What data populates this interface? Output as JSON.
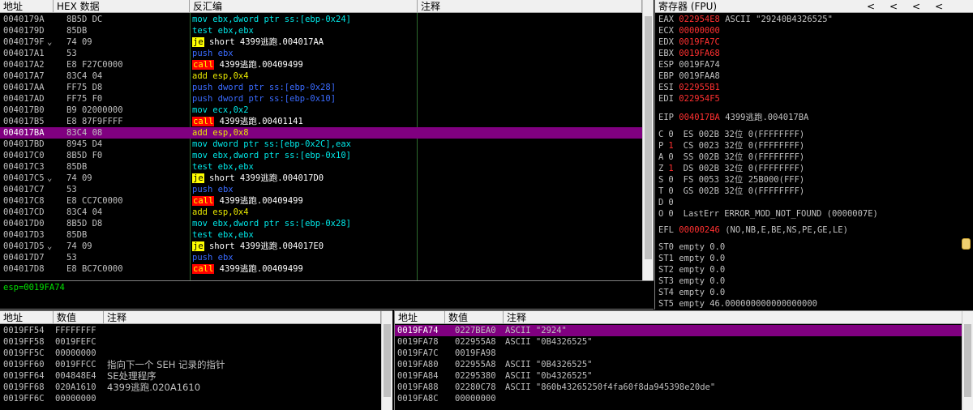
{
  "cpu": {
    "headers": {
      "addr": "地址",
      "hex": "HEX 数据",
      "disasm": "反汇编",
      "comment": "注释"
    },
    "rows": [
      {
        "addr": "0040179A",
        "mark": "",
        "hex": "8B5D DC",
        "mn": "mov",
        "mc": "c-mov",
        "op": " ebx,dword ptr ss:[ebp-0x24]",
        "sel": false
      },
      {
        "addr": "0040179D",
        "mark": "",
        "hex": "85DB",
        "mn": "test",
        "mc": "c-test",
        "op": " ebx,ebx",
        "sel": false
      },
      {
        "addr": "0040179F",
        "mark": "⌄",
        "hex": "74 09",
        "mn": "je",
        "mc": "c-je",
        "op": " short 4399逃跑.004017AA",
        "sel": false
      },
      {
        "addr": "004017A1",
        "mark": "",
        "hex": "53",
        "mn": "push",
        "mc": "c-push",
        "op": " ebx",
        "sel": false
      },
      {
        "addr": "004017A2",
        "mark": "",
        "hex": "E8 F27C0000",
        "mn": "call",
        "mc": "c-call",
        "op": " 4399逃跑.00409499",
        "sel": false
      },
      {
        "addr": "004017A7",
        "mark": "",
        "hex": "83C4 04",
        "mn": "add",
        "mc": "c-add",
        "op": " esp,0x4",
        "sel": false
      },
      {
        "addr": "004017AA",
        "mark": "",
        "hex": "FF75 D8",
        "mn": "push",
        "mc": "c-push",
        "op": " dword ptr ss:[ebp-0x28]",
        "sel": false
      },
      {
        "addr": "004017AD",
        "mark": "",
        "hex": "FF75 F0",
        "mn": "push",
        "mc": "c-push",
        "op": " dword ptr ss:[ebp-0x10]",
        "sel": false
      },
      {
        "addr": "004017B0",
        "mark": "",
        "hex": "B9 02000000",
        "mn": "mov",
        "mc": "c-mov",
        "op": " ecx,0x2",
        "sel": false
      },
      {
        "addr": "004017B5",
        "mark": "",
        "hex": "E8 87F9FFFF",
        "mn": "call",
        "mc": "c-call",
        "op": " 4399逃跑.00401141",
        "sel": false
      },
      {
        "addr": "004017BA",
        "mark": "",
        "hex": "83C4 08",
        "mn": "add",
        "mc": "c-add",
        "op": " esp,0x8",
        "sel": true
      },
      {
        "addr": "004017BD",
        "mark": "",
        "hex": "8945 D4",
        "mn": "mov",
        "mc": "c-mov",
        "op": " dword ptr ss:[ebp-0x2C],eax",
        "sel": false
      },
      {
        "addr": "004017C0",
        "mark": "",
        "hex": "8B5D F0",
        "mn": "mov",
        "mc": "c-mov",
        "op": " ebx,dword ptr ss:[ebp-0x10]",
        "sel": false
      },
      {
        "addr": "004017C3",
        "mark": "",
        "hex": "85DB",
        "mn": "test",
        "mc": "c-test",
        "op": " ebx,ebx",
        "sel": false
      },
      {
        "addr": "004017C5",
        "mark": "⌄",
        "hex": "74 09",
        "mn": "je",
        "mc": "c-je",
        "op": " short 4399逃跑.004017D0",
        "sel": false
      },
      {
        "addr": "004017C7",
        "mark": "",
        "hex": "53",
        "mn": "push",
        "mc": "c-push",
        "op": " ebx",
        "sel": false
      },
      {
        "addr": "004017C8",
        "mark": "",
        "hex": "E8 CC7C0000",
        "mn": "call",
        "mc": "c-call",
        "op": " 4399逃跑.00409499",
        "sel": false
      },
      {
        "addr": "004017CD",
        "mark": "",
        "hex": "83C4 04",
        "mn": "add",
        "mc": "c-add",
        "op": " esp,0x4",
        "sel": false
      },
      {
        "addr": "004017D0",
        "mark": "",
        "hex": "8B5D D8",
        "mn": "mov",
        "mc": "c-mov",
        "op": " ebx,dword ptr ss:[ebp-0x28]",
        "sel": false
      },
      {
        "addr": "004017D3",
        "mark": "",
        "hex": "85DB",
        "mn": "test",
        "mc": "c-test",
        "op": " ebx,ebx",
        "sel": false
      },
      {
        "addr": "004017D5",
        "mark": "⌄",
        "hex": "74 09",
        "mn": "je",
        "mc": "c-je",
        "op": " short 4399逃跑.004017E0",
        "sel": false
      },
      {
        "addr": "004017D7",
        "mark": "",
        "hex": "53",
        "mn": "push",
        "mc": "c-push",
        "op": " ebx",
        "sel": false
      },
      {
        "addr": "004017D8",
        "mark": "",
        "hex": "E8 BC7C0000",
        "mn": "call",
        "mc": "c-call",
        "op": " 4399逃跑.00409499",
        "sel": false
      }
    ],
    "info": "esp=0019FA74"
  },
  "registers": {
    "title": "寄存器 (FPU)",
    "nav": [
      "<",
      "<",
      "<",
      "<"
    ],
    "gp": [
      {
        "name": "EAX",
        "val": "022954E8",
        "note": " ASCII \"29240B4326525\"",
        "red": true
      },
      {
        "name": "ECX",
        "val": "00000000",
        "note": "",
        "red": true
      },
      {
        "name": "EDX",
        "val": "0019FA7C",
        "note": "",
        "red": true
      },
      {
        "name": "EBX",
        "val": "0019FA68",
        "note": "",
        "red": true
      },
      {
        "name": "ESP",
        "val": "0019FA74",
        "note": "",
        "red": false
      },
      {
        "name": "EBP",
        "val": "0019FAA8",
        "note": "",
        "red": false
      },
      {
        "name": "ESI",
        "val": "022955B1",
        "note": "",
        "red": true
      },
      {
        "name": "EDI",
        "val": "022954F5",
        "note": "",
        "red": true
      }
    ],
    "eip": {
      "name": "EIP",
      "val": "004017BA",
      "note": " 4399逃跑.004017BA"
    },
    "flags": [
      {
        "f": "C",
        "v": "0",
        "red": false,
        "seg": "ES 002B 32位 0(FFFFFFFF)"
      },
      {
        "f": "P",
        "v": "1",
        "red": true,
        "seg": "CS 0023 32位 0(FFFFFFFF)"
      },
      {
        "f": "A",
        "v": "0",
        "red": false,
        "seg": "SS 002B 32位 0(FFFFFFFF)"
      },
      {
        "f": "Z",
        "v": "1",
        "red": true,
        "seg": "DS 002B 32位 0(FFFFFFFF)"
      },
      {
        "f": "S",
        "v": "0",
        "red": false,
        "seg": "FS 0053 32位 25B000(FFF)"
      },
      {
        "f": "T",
        "v": "0",
        "red": false,
        "seg": "GS 002B 32位 0(FFFFFFFF)"
      },
      {
        "f": "D",
        "v": "0",
        "red": false,
        "seg": ""
      },
      {
        "f": "O",
        "v": "0",
        "red": false,
        "seg": "LastErr ERROR_MOD_NOT_FOUND (0000007E)"
      }
    ],
    "efl": {
      "name": "EFL",
      "val": "00000246",
      "note": " (NO,NB,E,BE,NS,PE,GE,LE)"
    },
    "fpu": [
      "ST0 empty 0.0",
      "ST1 empty 0.0",
      "ST2 empty 0.0",
      "ST3 empty 0.0",
      "ST4 empty 0.0",
      "ST5 empty 46.000000000000000000"
    ]
  },
  "dump": {
    "headers": {
      "addr": "地址",
      "val": "数值",
      "comment": "注释"
    },
    "rows": [
      {
        "addr": "0019FF54",
        "val": "FFFFFFFF",
        "comment": ""
      },
      {
        "addr": "0019FF58",
        "val": "0019FEFC",
        "comment": ""
      },
      {
        "addr": "0019FF5C",
        "val": "00000000",
        "comment": ""
      },
      {
        "addr": "0019FF60",
        "val": "0019FFCC",
        "comment": "指向下一个 SEH 记录的指针"
      },
      {
        "addr": "0019FF64",
        "val": "004848E4",
        "comment": "SE处理程序"
      },
      {
        "addr": "0019FF68",
        "val": "020A1610",
        "comment": "4399逃跑.020A1610"
      },
      {
        "addr": "0019FF6C",
        "val": "00000000",
        "comment": ""
      }
    ]
  },
  "stack": {
    "headers": {
      "addr": "地址",
      "val": "数值",
      "comment": "注释"
    },
    "rows": [
      {
        "addr": "0019FA74",
        "val": "0227BEA0",
        "comment": "ASCII \"2924\"",
        "sel": true
      },
      {
        "addr": "0019FA78",
        "val": "022955A8",
        "comment": "ASCII \"0B4326525\"",
        "sel": false
      },
      {
        "addr": "0019FA7C",
        "val": "0019FA98",
        "comment": "",
        "sel": false
      },
      {
        "addr": "0019FA80",
        "val": "022955A8",
        "comment": "ASCII \"0B4326525\"",
        "sel": false
      },
      {
        "addr": "0019FA84",
        "val": "02295380",
        "comment": "ASCII \"0b4326525\"",
        "sel": false
      },
      {
        "addr": "0019FA88",
        "val": "02280C78",
        "comment": "ASCII \"860b43265250f4fa60f8da945398e20de\"",
        "sel": false
      },
      {
        "addr": "0019FA8C",
        "val": "00000000",
        "comment": "",
        "sel": false
      }
    ]
  },
  "colors": {
    "selection": "#800080",
    "jump_bg": "#ffff00",
    "call_bg": "#ff0000",
    "mov": "#00e8e8",
    "push": "#3a6bff",
    "add": "#e8e800",
    "reg_changed": "#ff3030"
  }
}
